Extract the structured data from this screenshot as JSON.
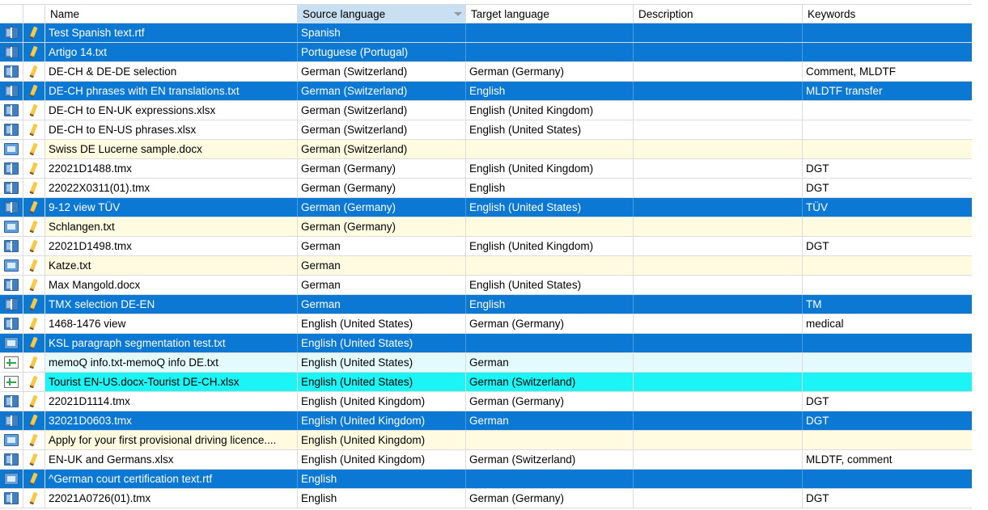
{
  "header": {
    "name": "Name",
    "source": "Source language",
    "target": "Target language",
    "description": "Description",
    "keywords": "Keywords"
  },
  "rows": [
    {
      "style": "blue",
      "icon": "tm-icon",
      "name": "Test Spanish text.rtf",
      "source": "Spanish",
      "target": "",
      "description": "",
      "keywords": ""
    },
    {
      "style": "blue",
      "icon": "tm-icon",
      "name": "Artigo 14.txt",
      "source": "Portuguese (Portugal)",
      "target": "",
      "description": "",
      "keywords": ""
    },
    {
      "style": "white",
      "icon": "tm-icon",
      "name": "DE-CH & DE-DE selection",
      "source": "German (Switzerland)",
      "target": "German (Germany)",
      "description": "",
      "keywords": "Comment, MLDTF"
    },
    {
      "style": "blue",
      "icon": "tm-icon",
      "name": "DE-CH phrases with EN translations.txt",
      "source": "German (Switzerland)",
      "target": "English",
      "description": "",
      "keywords": "MLDTF transfer"
    },
    {
      "style": "white",
      "icon": "tm-icon",
      "name": "DE-CH to EN-UK expressions.xlsx",
      "source": "German (Switzerland)",
      "target": "English (United Kingdom)",
      "description": "",
      "keywords": ""
    },
    {
      "style": "white",
      "icon": "tm-icon",
      "name": "DE-CH to EN-US phrases.xlsx",
      "source": "German (Switzerland)",
      "target": "English (United States)",
      "description": "",
      "keywords": ""
    },
    {
      "style": "yellow",
      "icon": "doc-icon",
      "name": "Swiss DE Lucerne sample.docx",
      "source": "German (Switzerland)",
      "target": "",
      "description": "",
      "keywords": ""
    },
    {
      "style": "white",
      "icon": "tm-icon",
      "name": "22021D1488.tmx",
      "source": "German (Germany)",
      "target": "English (United Kingdom)",
      "description": "",
      "keywords": "DGT"
    },
    {
      "style": "white",
      "icon": "tm-icon",
      "name": "22022X0311(01).tmx",
      "source": "German (Germany)",
      "target": "English",
      "description": "",
      "keywords": "DGT"
    },
    {
      "style": "blue",
      "icon": "tm-icon",
      "name": "9-12 view TÜV",
      "source": "German (Germany)",
      "target": "English (United States)",
      "description": "",
      "keywords": "TÜV"
    },
    {
      "style": "yellow",
      "icon": "doc-icon",
      "name": "Schlangen.txt",
      "source": "German (Germany)",
      "target": "",
      "description": "",
      "keywords": ""
    },
    {
      "style": "white",
      "icon": "tm-icon",
      "name": "22021D1498.tmx",
      "source": "German",
      "target": "English (United Kingdom)",
      "description": "",
      "keywords": "DGT"
    },
    {
      "style": "yellow",
      "icon": "doc-icon",
      "name": "Katze.txt",
      "source": "German",
      "target": "",
      "description": "",
      "keywords": ""
    },
    {
      "style": "white",
      "icon": "tm-icon",
      "name": "Max Mangold.docx",
      "source": "German",
      "target": "English (United States)",
      "description": "",
      "keywords": ""
    },
    {
      "style": "blue",
      "icon": "tm-icon",
      "name": "TMX selection DE-EN",
      "source": "German",
      "target": "English",
      "description": "",
      "keywords": "TM"
    },
    {
      "style": "white",
      "icon": "tm-icon",
      "name": "1468-1476 view",
      "source": "English (United States)",
      "target": "German (Germany)",
      "description": "",
      "keywords": "medical"
    },
    {
      "style": "blue",
      "icon": "doc-icon",
      "name": "KSL paragraph segmentation test.txt",
      "source": "English (United States)",
      "target": "",
      "description": "",
      "keywords": ""
    },
    {
      "style": "lightcyan",
      "icon": "bilingual-icon",
      "name": "memoQ info.txt-memoQ info DE.txt",
      "source": "English (United States)",
      "target": "German",
      "description": "",
      "keywords": ""
    },
    {
      "style": "cyan",
      "icon": "bilingual-icon",
      "name": "Tourist EN-US.docx-Tourist DE-CH.xlsx",
      "source": "English (United States)",
      "target": "German (Switzerland)",
      "description": "",
      "keywords": ""
    },
    {
      "style": "white",
      "icon": "tm-icon",
      "name": "22021D1114.tmx",
      "source": "English (United Kingdom)",
      "target": "German (Germany)",
      "description": "",
      "keywords": "DGT"
    },
    {
      "style": "blue",
      "icon": "tm-icon",
      "name": "32021D0603.tmx",
      "source": "English (United Kingdom)",
      "target": "German",
      "description": "",
      "keywords": "DGT"
    },
    {
      "style": "yellow",
      "icon": "doc-icon",
      "name": "Apply for your first provisional driving licence....",
      "source": "English (United Kingdom)",
      "target": "",
      "description": "",
      "keywords": ""
    },
    {
      "style": "white",
      "icon": "tm-icon",
      "name": "EN-UK and Germans.xlsx",
      "source": "English (United Kingdom)",
      "target": "German (Switzerland)",
      "description": "",
      "keywords": "MLDTF, comment"
    },
    {
      "style": "blue",
      "icon": "doc-icon",
      "name": "^German court certification text.rtf",
      "source": "English",
      "target": "",
      "description": "",
      "keywords": ""
    },
    {
      "style": "white",
      "icon": "tm-icon",
      "name": "22021A0726(01).tmx",
      "source": "English",
      "target": "German (Germany)",
      "description": "",
      "keywords": "DGT"
    }
  ],
  "colors": {
    "selected_row": "#0b78d4",
    "document_row": "#fffbe0",
    "bilingual_row": "#e3fbfe",
    "bilingual_row_selected": "#1cf5f5",
    "sorted_header": "#c9dff2"
  }
}
